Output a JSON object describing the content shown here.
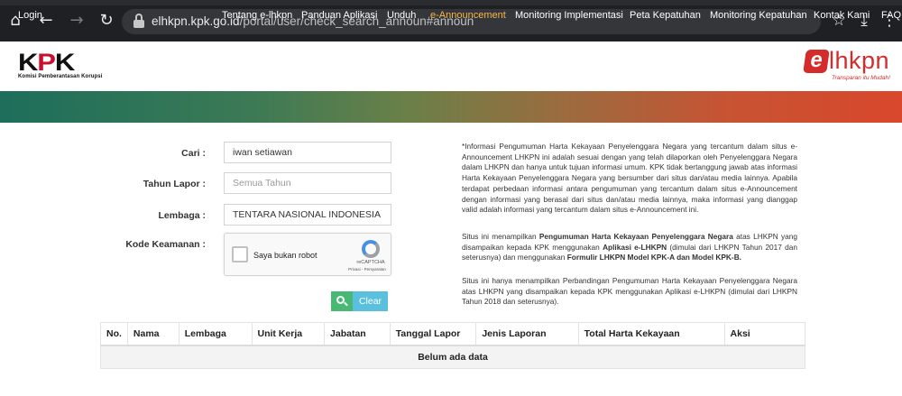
{
  "browser": {
    "url_host": "elhkpn.kpk.go.id",
    "url_path": "/portal/user/check_search_announ#announ",
    "icons": {
      "home": "home-icon",
      "back": "back-arrow-icon",
      "forward": "forward-arrow-icon",
      "reload": "reload-icon",
      "lock": "lock-icon",
      "star": "star-icon",
      "download": "download-icon",
      "menu": "kebab-menu-icon"
    }
  },
  "header": {
    "kpk_logo_text": "KPK",
    "kpk_subtitle": "Komisi Pemberantasan Korupsi",
    "elhkpn_e": "e",
    "elhkpn_rest": "lhkpn",
    "elhkpn_tagline": "Transparan itu Mudah!"
  },
  "nav": {
    "login": "Login",
    "items": [
      {
        "label": "Tentang e-lhkpn",
        "active": false
      },
      {
        "label": "Panduan Aplikasi",
        "active": false
      },
      {
        "label": "Unduh",
        "active": false
      },
      {
        "label": "e-Announcement",
        "active": true
      },
      {
        "label": "Monitoring Implementasi",
        "active": false
      },
      {
        "label": "Peta Kepatuhan",
        "active": false
      },
      {
        "label": "Monitoring Kepatuhan",
        "active": false
      },
      {
        "label": "Kontak Kami",
        "active": false
      },
      {
        "label": "FAQ",
        "active": false
      }
    ],
    "colors": {
      "active": "#f7b74a",
      "start": "#1d6e5b",
      "end": "#d9472c"
    }
  },
  "form": {
    "cari_label": "Cari :",
    "cari_value": "iwan setiawan",
    "tahun_label": "Tahun Lapor :",
    "tahun_placeholder": "Semua Tahun",
    "lembaga_label": "Lembaga :",
    "lembaga_value": "TENTARA NASIONAL INDONESIA",
    "kode_label": "Kode Keamanan :",
    "recaptcha_label": "Saya bukan robot",
    "recaptcha_brand": "reCAPTCHA",
    "recaptcha_links": "Privasi - Persyaratan",
    "clear_label": "Clear"
  },
  "info": {
    "p1": "*Informasi Pengumuman Harta Kekayaan Penyelenggara Negara yang tercantum dalam situs e-Announcement LHKPN ini adalah sesuai dengan yang telah dilaporkan oleh Penyelenggara Negara dalam LHKPN dan hanya untuk tujuan informasi umum. KPK tidak bertanggung jawab atas informasi Harta Kekayaan Penyelenggara Negara yang bersumber dari situs dan/atau media lainnya. Apabila terdapat perbedaan informasi antara pengumuman yang tercantum dalam situs e-Announcement dengan informasi yang berasal dari situs dan/atau media lainnya, maka informasi yang dianggap valid adalah informasi yang tercantum dalam situs e-Announcement ini.",
    "p2_a": "Situs ini menampilkan ",
    "p2_b": "Pengumuman Harta Kekayaan Penyelenggara Negara",
    "p2_c": " atas LHKPN yang disampaikan kepada KPK menggunakan ",
    "p2_d": "Aplikasi e-LHKPN",
    "p2_e": " (dimulai dari LHKPN Tahun 2017 dan seterusnya) dan menggunakan ",
    "p2_f": "Formulir LHKPN Model KPK-A dan Model KPK-B.",
    "p3": "Situs ini hanya menampilkan Perbandingan Pengumuman Harta Kekayaan Penyelenggara Negara atas LHKPN yang disampaikan kepada KPK menggunakan Aplikasi e-LHKPN (dimulai dari LHKPN Tahun 2018 dan seterusnya)."
  },
  "table": {
    "columns": [
      "No.",
      "Nama",
      "Lembaga",
      "Unit Kerja",
      "Jabatan",
      "Tanggal Lapor",
      "Jenis Laporan",
      "Total Harta Kekayaan",
      "Aksi"
    ],
    "empty_message": "Belum ada data"
  }
}
